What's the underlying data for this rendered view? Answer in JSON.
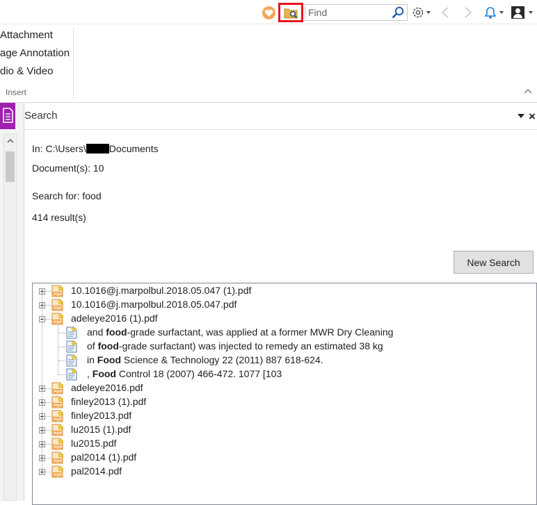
{
  "toolbar": {
    "find_placeholder": "Find",
    "highlight_color": "#e8141c"
  },
  "ribbon": {
    "items": [
      "Attachment",
      "age Annotation",
      "dio & Video"
    ],
    "group_label": "Insert"
  },
  "search_panel": {
    "title": "Search",
    "in_prefix": "In: C:\\Users\\",
    "in_suffix": "Documents",
    "documents_line": "Document(s): 10",
    "search_for_line": "Search for: food",
    "result_count_line": "414 result(s)",
    "new_search_label": "New Search"
  },
  "results": [
    {
      "file": "10.1016@j.marpolbul.2018.05.047 (1).pdf",
      "expanded": false
    },
    {
      "file": "10.1016@j.marpolbul.2018.05.047.pdf",
      "expanded": false
    },
    {
      "file": "adeleye2016 (1).pdf",
      "expanded": true,
      "matches": [
        {
          "before": "and ",
          "match": "food",
          "after": "-grade surfactant, was applied at a former MWR Dry Cleaning"
        },
        {
          "before": "of ",
          "match": "food",
          "after": "-grade surfactant) was injected to remedy an estimated 38 kg"
        },
        {
          "before": "in ",
          "match": "Food",
          "after": " Science & Technology 22 (2011) 887 618-624."
        },
        {
          "before": ", ",
          "match": "Food",
          "after": " Control 18 (2007) 466-472. 1077 [103"
        }
      ]
    },
    {
      "file": "adeleye2016.pdf",
      "expanded": false
    },
    {
      "file": "finley2013 (1).pdf",
      "expanded": false
    },
    {
      "file": "finley2013.pdf",
      "expanded": false
    },
    {
      "file": "lu2015 (1).pdf",
      "expanded": false
    },
    {
      "file": "lu2015.pdf",
      "expanded": false
    },
    {
      "file": "pal2014 (1).pdf",
      "expanded": false
    },
    {
      "file": "pal2014.pdf",
      "expanded": false
    }
  ]
}
